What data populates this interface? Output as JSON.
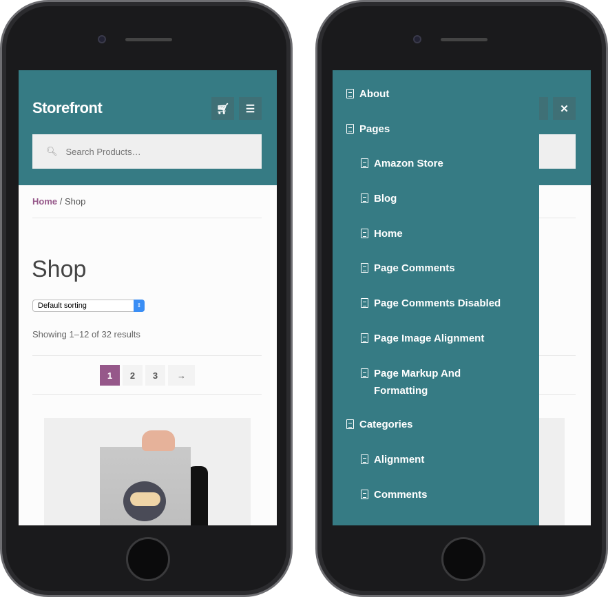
{
  "colors": {
    "brand": "#367b84",
    "accent": "#96588a"
  },
  "left": {
    "logo": "Storefront",
    "cart_icon": "cart-icon",
    "menu_icon": "hamburger-icon",
    "search": {
      "placeholder": "Search Products…"
    },
    "breadcrumb": {
      "home": "Home",
      "sep": " / ",
      "current": "Shop"
    },
    "title": "Shop",
    "sorting": "Default sorting",
    "result_count": "Showing 1–12 of 32 results",
    "pagination": [
      "1",
      "2",
      "3",
      "→"
    ],
    "current_page": "1"
  },
  "right": {
    "close_icon": "close-icon",
    "menu": [
      {
        "label": "About",
        "level": 0
      },
      {
        "label": "Pages",
        "level": 0
      },
      {
        "label": "Amazon Store",
        "level": 1
      },
      {
        "label": "Blog",
        "level": 1
      },
      {
        "label": "Home",
        "level": 1
      },
      {
        "label": "Page Comments",
        "level": 1
      },
      {
        "label": "Page Comments Disabled",
        "level": 1
      },
      {
        "label": "Page Image Alignment",
        "level": 1
      },
      {
        "label": "Page Markup And Formatting",
        "level": 1
      },
      {
        "label": "Categories",
        "level": 0
      },
      {
        "label": "Alignment",
        "level": 1
      },
      {
        "label": "Comments",
        "level": 1
      }
    ]
  }
}
